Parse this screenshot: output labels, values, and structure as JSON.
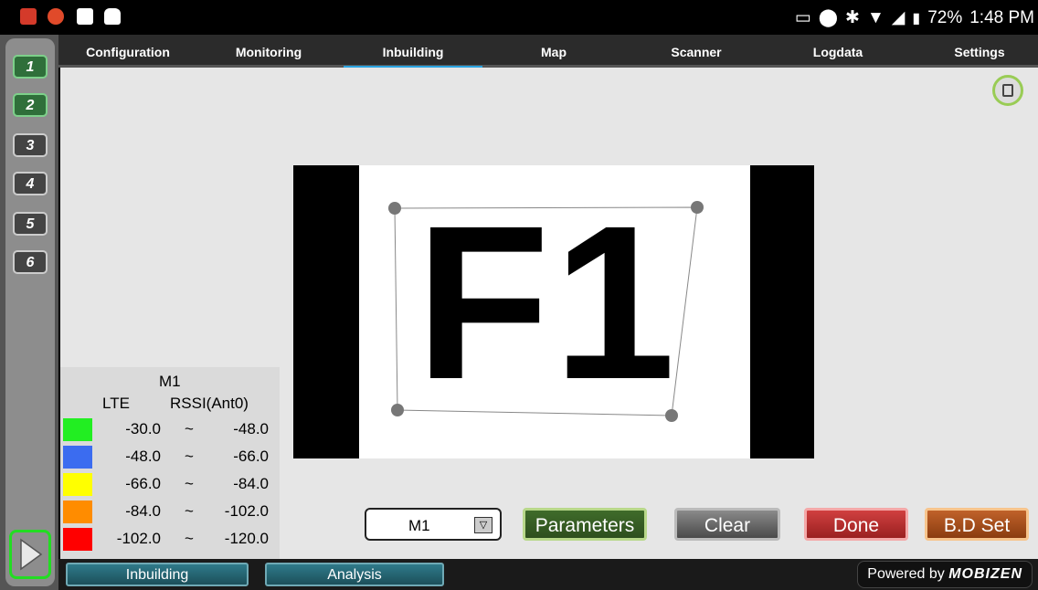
{
  "status_bar": {
    "battery": "72%",
    "time": "1:48 PM",
    "left_icons": [
      "app-m-icon",
      "signal-app-icon",
      "square-app-icon",
      "robot-icon"
    ],
    "right_icons": [
      "cast-icon",
      "location-icon",
      "bluetooth-icon",
      "wifi-icon",
      "cell-signal-icon",
      "battery-icon"
    ]
  },
  "sidebar": {
    "buttons": [
      {
        "label": "1",
        "active": true
      },
      {
        "label": "2",
        "active": true
      },
      {
        "label": "3",
        "active": false
      },
      {
        "label": "4",
        "active": false
      },
      {
        "label": "5",
        "active": false
      },
      {
        "label": "6",
        "active": false
      }
    ]
  },
  "tabs": {
    "items": [
      "Configuration",
      "Monitoring",
      "Inbuilding",
      "Map",
      "Scanner",
      "Logdata",
      "Settings"
    ],
    "active": "Inbuilding"
  },
  "floorplan": {
    "label": "F1"
  },
  "legend": {
    "title": "M1",
    "col1": "LTE",
    "col2": "RSSI(Ant0)",
    "rows": [
      {
        "color": "#22ee22",
        "from": "-30.0",
        "sep": "~",
        "to": "-48.0"
      },
      {
        "color": "#3b6cf0",
        "from": "-48.0",
        "sep": "~",
        "to": "-66.0"
      },
      {
        "color": "#ffff00",
        "from": "-66.0",
        "sep": "~",
        "to": "-84.0"
      },
      {
        "color": "#ff8c00",
        "from": "-84.0",
        "sep": "~",
        "to": "-102.0"
      },
      {
        "color": "#ff0000",
        "from": "-102.0",
        "sep": "~",
        "to": "-120.0"
      }
    ]
  },
  "controls": {
    "select_value": "M1",
    "parameters": "Parameters",
    "clear": "Clear",
    "done": "Done",
    "bd_set": "B.D Set"
  },
  "bottom": {
    "inbuilding": "Inbuilding",
    "analysis": "Analysis",
    "powered_by": "Powered by",
    "brand": "MOBIZEN"
  }
}
